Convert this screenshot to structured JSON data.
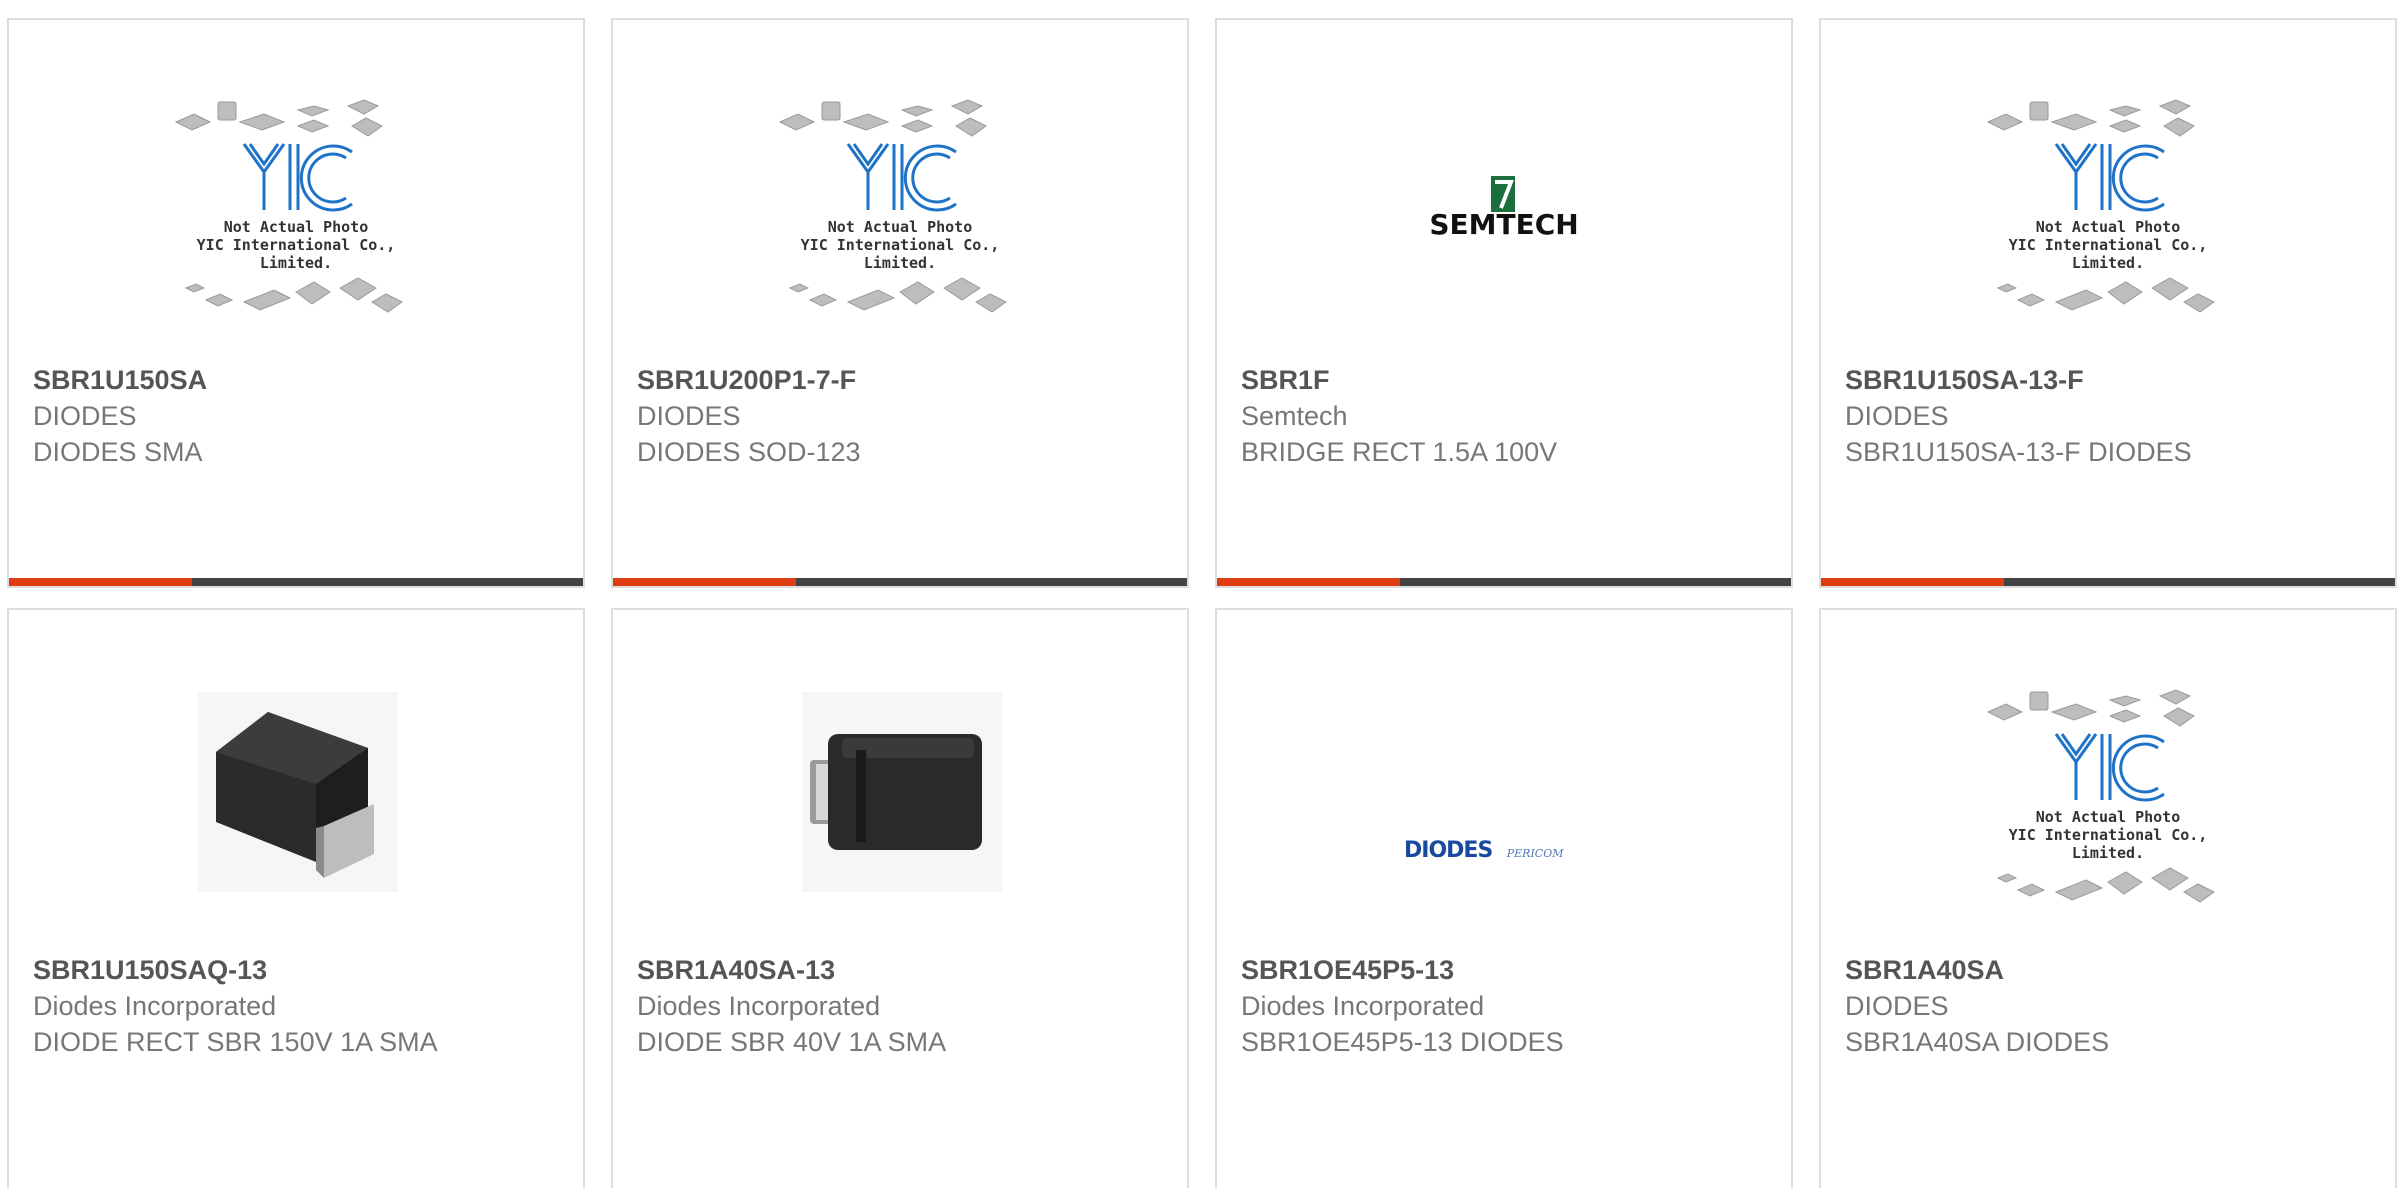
{
  "products": [
    {
      "part": "SBR1U150SA",
      "manufacturer": "DIODES",
      "description": "DIODES SMA",
      "image": "placeholder-not-actual-photo"
    },
    {
      "part": "SBR1U200P1-7-F",
      "manufacturer": "DIODES",
      "description": "DIODES SOD-123",
      "image": "placeholder-not-actual-photo"
    },
    {
      "part": "SBR1F",
      "manufacturer": "Semtech",
      "description": "BRIDGE RECT 1.5A 100V",
      "image": "semtech-logo"
    },
    {
      "part": "SBR1U150SA-13-F",
      "manufacturer": "DIODES",
      "description": "SBR1U150SA-13-F DIODES",
      "image": "placeholder-not-actual-photo"
    },
    {
      "part": "SBR1U150SAQ-13",
      "manufacturer": "Diodes Incorporated",
      "description": "DIODE RECT SBR 150V 1A SMA",
      "image": "sma-package-photo"
    },
    {
      "part": "SBR1A40SA-13",
      "manufacturer": "Diodes Incorporated",
      "description": "DIODE SBR 40V 1A SMA",
      "image": "sma-package-photo"
    },
    {
      "part": "SBR1OE45P5-13",
      "manufacturer": "Diodes Incorporated",
      "description": "SBR1OE45P5-13 DIODES",
      "image": "diodes-logo"
    },
    {
      "part": "SBR1A40SA",
      "manufacturer": "DIODES",
      "description": "SBR1A40SA DIODES",
      "image": "placeholder-not-actual-photo"
    }
  ],
  "placeholder": {
    "line1": "Not Actual Photo",
    "line2": "YIC International Co., Limited.",
    "logo": "YIC"
  },
  "logos": {
    "semtech": "SEMTECH",
    "diodes": "DIODES",
    "pericom": "PERICOM"
  },
  "colors": {
    "accent": "#e03c14",
    "bar": "#444444",
    "border": "#dddddd",
    "yic_blue": "#1e73c8"
  }
}
